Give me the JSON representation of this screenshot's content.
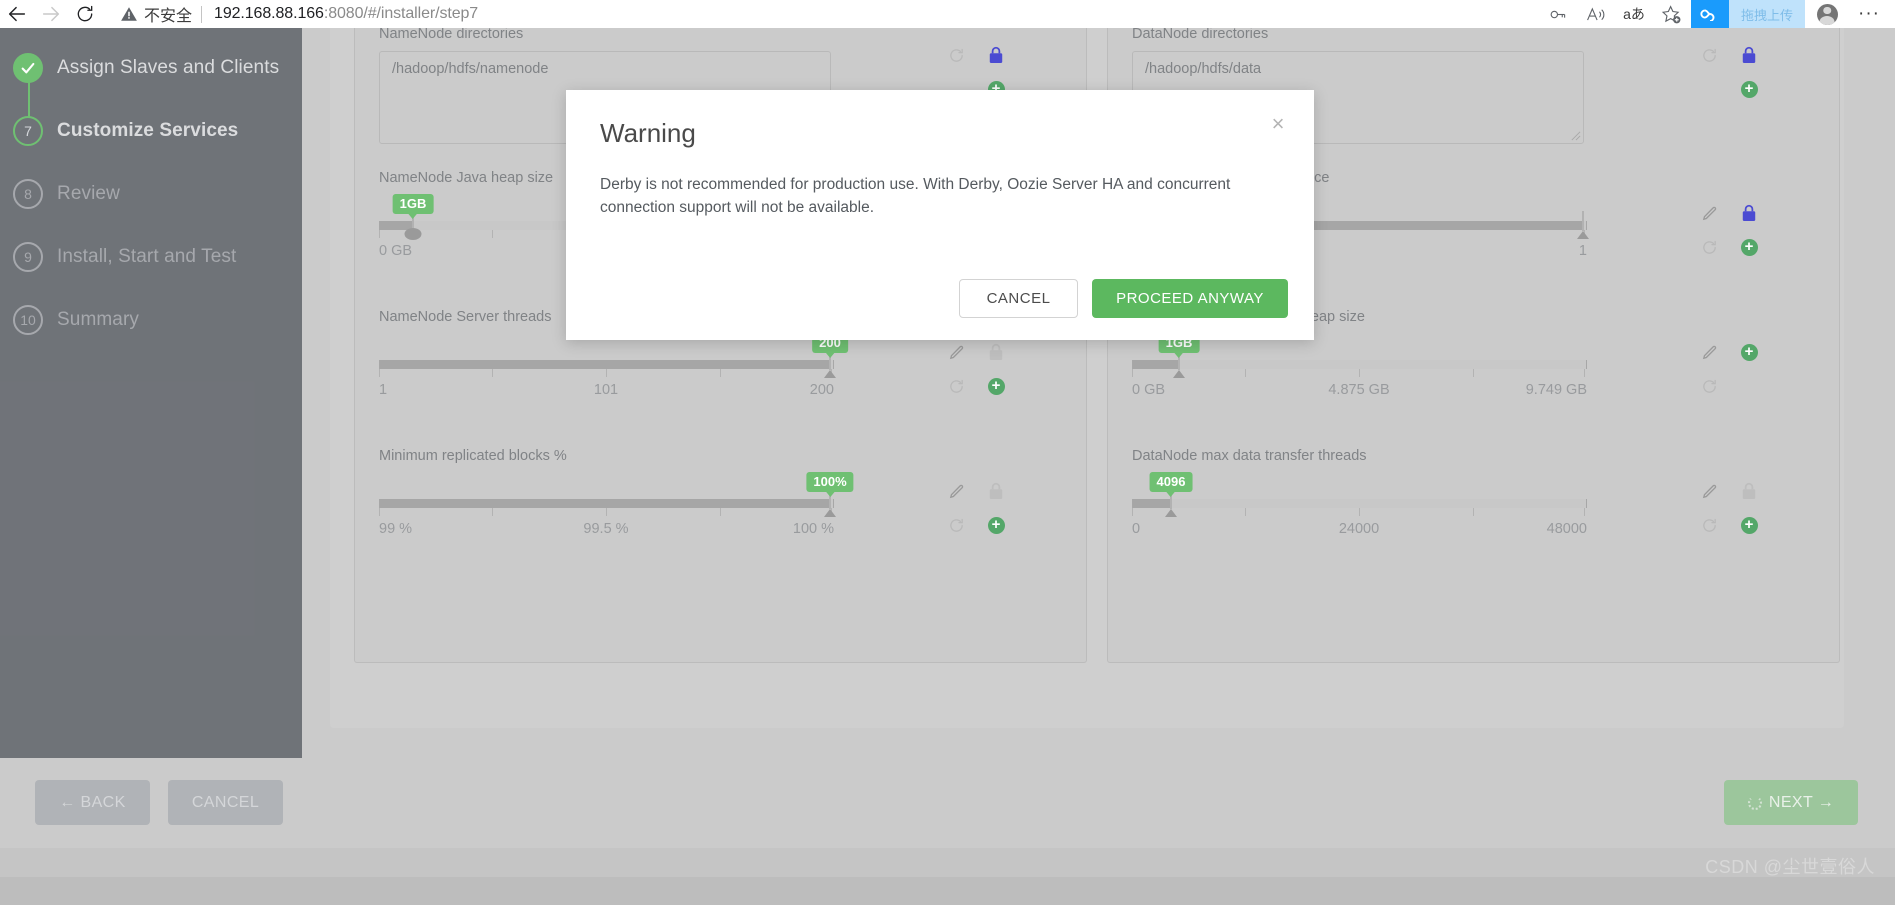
{
  "browser": {
    "back_icon": "back-arrow-icon",
    "forward_icon": "forward-arrow-icon",
    "reload_icon": "reload-icon",
    "security_label": "不安全",
    "url_host": "192.168.88.166",
    "url_rest": ":8080/#/installer/step7",
    "toolbar_icons": [
      {
        "name": "password-key-icon",
        "glyph": ""
      },
      {
        "name": "read-aloud-icon",
        "glyph": ""
      },
      {
        "name": "translate-icon",
        "glyph": "aあ"
      },
      {
        "name": "add-favorite-icon",
        "glyph": ""
      }
    ],
    "extension": {
      "name": "drag-upload-extension",
      "tooltip": "拖拽上传"
    },
    "profile_name": "profile-avatar",
    "menu_label": "···"
  },
  "sidebar": {
    "steps": [
      {
        "num": "",
        "label": "Assign Slaves and Clients",
        "state": "done"
      },
      {
        "num": "7",
        "label": "Customize Services",
        "state": "active"
      },
      {
        "num": "8",
        "label": "Review",
        "state": "pending"
      },
      {
        "num": "9",
        "label": "Install, Start and Test",
        "state": "pending"
      },
      {
        "num": "10",
        "label": "Summary",
        "state": "pending"
      }
    ]
  },
  "left_column": {
    "namenode_directories": {
      "label": "NameNode directories",
      "value": "/hadoop/hdfs/namenode",
      "lock_state": "locked"
    },
    "namenode_heap": {
      "label": "NameNode Java heap size",
      "bubble": "1GB",
      "axis": [
        "0 GB",
        "",
        ""
      ],
      "fill_percent": 7
    },
    "namenode_threads": {
      "label": "NameNode Server threads",
      "bubble": "200",
      "axis": [
        "1",
        "101",
        "200"
      ],
      "fill_percent": 97
    },
    "min_replicated_blocks": {
      "label": "Minimum replicated blocks %",
      "bubble": "100%",
      "axis": [
        "99 %",
        "99.5 %",
        "100 %"
      ],
      "fill_percent": 97
    }
  },
  "right_column": {
    "datanode_directories": {
      "label": "DataNode directories",
      "value": "/hadoop/hdfs/data",
      "lock_state": "locked"
    },
    "datanode_failed_disk": {
      "label": "DataNode failed disk tolerance",
      "bubble": "",
      "axis": [
        "",
        "",
        "1"
      ],
      "fill_percent": 97
    },
    "datanode_heap": {
      "label": "DataNode maximum Java heap size",
      "bubble": "1GB",
      "axis": [
        "0 GB",
        "4.875 GB",
        "9.749 GB"
      ],
      "fill_percent": 10
    },
    "datanode_transfer_threads": {
      "label": "DataNode max data transfer threads",
      "bubble": "4096",
      "axis": [
        "0",
        "24000",
        "48000"
      ],
      "fill_percent": 8.5
    }
  },
  "icons": {
    "edit": "pencil-icon",
    "revert": "revert-icon",
    "lock": "lock-icon",
    "add_override": "add-property-override-icon"
  },
  "footer": {
    "back_label": "← BACK",
    "cancel_label": "CANCEL",
    "next_label": "NEXT →"
  },
  "modal": {
    "title": "Warning",
    "close_label": "×",
    "body": "Derby is not recommended for production use. With Derby, Oozie Server HA and concurrent connection support will not be available.",
    "cancel_label": "CANCEL",
    "proceed_label": "PROCEED ANYWAY"
  },
  "watermark": "CSDN @尘世壹俗人",
  "colors": {
    "accent_green": "#5cb85f",
    "lock_blue": "#3333cc",
    "sidebar_bg": "#5c6066"
  }
}
